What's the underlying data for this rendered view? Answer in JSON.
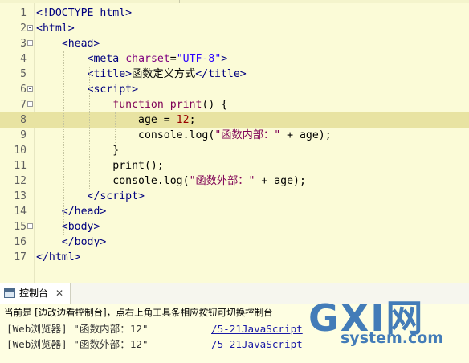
{
  "editor": {
    "current_line": 8,
    "lines": [
      {
        "num": "1",
        "fold": false,
        "html": "<span class=\"tag\">&lt;!DOCTYPE html&gt;</span>"
      },
      {
        "num": "2",
        "fold": true,
        "html": "<span class=\"tag\">&lt;html&gt;</span>"
      },
      {
        "num": "3",
        "fold": true,
        "html": "    <span class=\"tag\">&lt;head&gt;</span>"
      },
      {
        "num": "4",
        "fold": false,
        "html": "        <span class=\"tag\">&lt;meta</span> <span class=\"attr\">charset</span>=<span class=\"str\">\"UTF-8\"</span><span class=\"tag\">&gt;</span>"
      },
      {
        "num": "5",
        "fold": false,
        "html": "        <span class=\"tag\">&lt;title&gt;</span>函数定义方式<span class=\"tag\">&lt;/title&gt;</span>"
      },
      {
        "num": "6",
        "fold": true,
        "html": "        <span class=\"tag\">&lt;script&gt;</span>"
      },
      {
        "num": "7",
        "fold": true,
        "html": "            <span class=\"kw\">function</span> <span class=\"kw\">print</span>() {"
      },
      {
        "num": "8",
        "fold": false,
        "html": "                age = <span class=\"num\">12</span>;"
      },
      {
        "num": "9",
        "fold": false,
        "html": "                console.log(<span class=\"kw\">\"</span><span class=\"kw\">函数内部：\"</span> + age);"
      },
      {
        "num": "10",
        "fold": false,
        "html": "            }"
      },
      {
        "num": "11",
        "fold": false,
        "html": "            print();"
      },
      {
        "num": "12",
        "fold": false,
        "html": "            console.log(<span class=\"kw\">\"函数外部：\"</span> + age);"
      },
      {
        "num": "13",
        "fold": false,
        "html": "        <span class=\"tag\">&lt;/script&gt;</span>"
      },
      {
        "num": "14",
        "fold": false,
        "html": "    <span class=\"tag\">&lt;/head&gt;</span>"
      },
      {
        "num": "15",
        "fold": true,
        "html": "    <span class=\"tag\">&lt;body&gt;</span>"
      },
      {
        "num": "16",
        "fold": false,
        "html": "    <span class=\"tag\">&lt;/body&gt;</span>"
      },
      {
        "num": "17",
        "fold": false,
        "html": "<span class=\"tag\">&lt;/html&gt;</span>"
      }
    ]
  },
  "console": {
    "tab_label": "控制台",
    "close_glyph": "✕",
    "description": "当前是 [边改边看控制台]，点右上角工具条相应按钮可切换控制台",
    "output": [
      {
        "message": "[Web浏览器] \"函数内部：12\"",
        "link": "/5-21JavaScript"
      },
      {
        "message": "[Web浏览器] \"函数外部：12\"",
        "link": "/5-21JavaScript"
      }
    ]
  },
  "watermark": {
    "logo": "GXI网",
    "domain": "system.com"
  },
  "colors": {
    "editor_bg": "#fbfbd7",
    "current_line": "#e8e3a2",
    "tag": "#00007f",
    "keyword": "#7f0055",
    "string": "#2a00ff",
    "link": "#1a1aa6",
    "watermark": "#2f6fb4"
  }
}
